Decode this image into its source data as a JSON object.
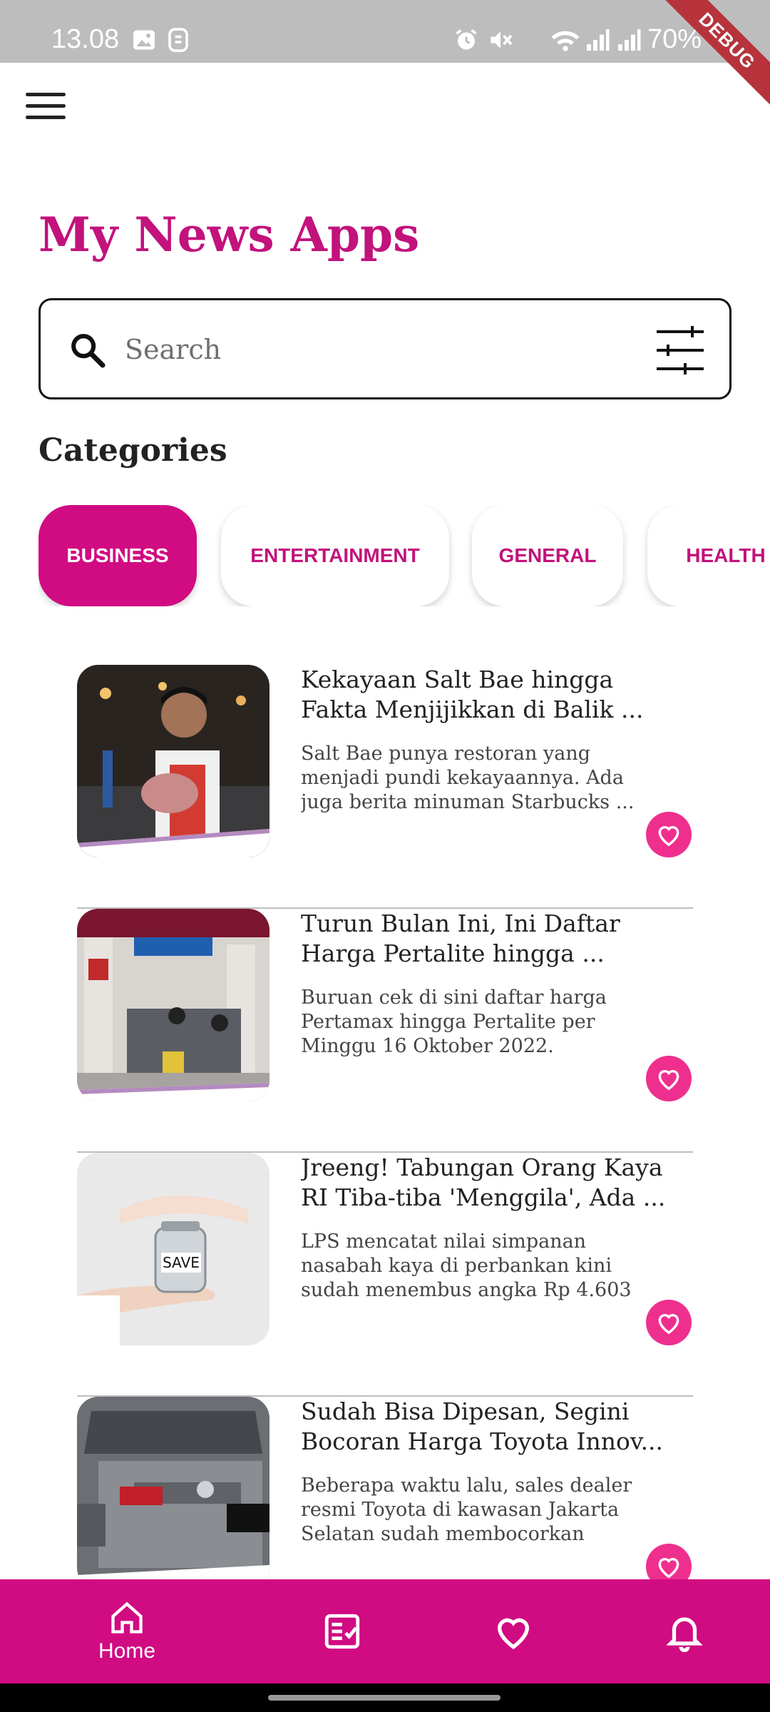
{
  "status_bar": {
    "time": "13.08",
    "battery": "70%",
    "debug_label": "DEBUG"
  },
  "app": {
    "title": "My News Apps"
  },
  "search": {
    "placeholder": "Search",
    "value": ""
  },
  "categories": {
    "title": "Categories",
    "items": [
      "BUSINESS",
      "ENTERTAINMENT",
      "GENERAL",
      "HEALTH"
    ],
    "selected": "BUSINESS"
  },
  "news": [
    {
      "title": "Kekayaan Salt Bae hingga Fakta Menjijikkan di Balik ...",
      "description": "Salt Bae punya restoran yang menjadi pundi kekayaannya. Ada juga berita minuman Starbucks ..."
    },
    {
      "title": "Turun Bulan Ini, Ini Daftar Harga Pertalite hingga ...",
      "description": "Buruan cek di sini daftar harga Pertamax hingga Pertalite per Minggu 16 Oktober 2022."
    },
    {
      "title": "Jreeng! Tabungan Orang Kaya RI Tiba-tiba 'Menggila', Ada ...",
      "description": "LPS mencatat nilai simpanan nasabah kaya di perbankan kini sudah menembus angka Rp 4.603 ..."
    },
    {
      "title": "Sudah Bisa Dipesan, Segini Bocoran Harga Toyota Innov...",
      "description": "Beberapa waktu lalu, sales dealer resmi Toyota di kawasan Jakarta Selatan sudah membocorkan bera..."
    }
  ],
  "bottom_nav": {
    "home_label": "Home",
    "items": [
      "home-icon",
      "news-list-icon",
      "heart-icon",
      "bell-icon"
    ]
  },
  "colors": {
    "accent": "#d10b82",
    "title": "#c2127c",
    "favorite": "#ef2f8e"
  }
}
